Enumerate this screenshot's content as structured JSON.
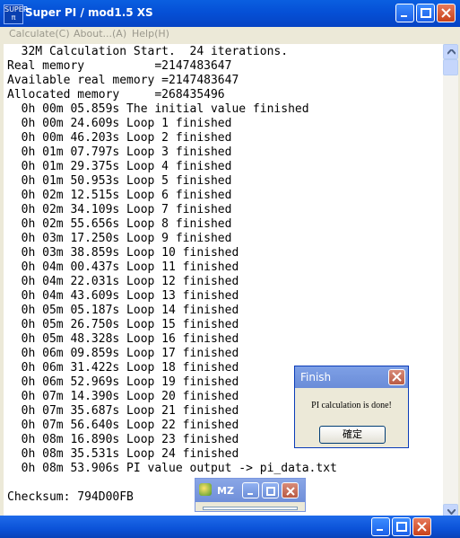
{
  "window": {
    "title": "Super PI / mod1.5 XS",
    "icon_text": [
      "SUPER",
      "π"
    ],
    "buttons": [
      "minimize",
      "maximize",
      "close"
    ]
  },
  "menu": [
    {
      "label": "Calculate(C)"
    },
    {
      "label": "About...(A)"
    },
    {
      "label": "Help(H)"
    }
  ],
  "console": {
    "lines": [
      "  32M Calculation Start.  24 iterations.",
      "Real memory          =2147483647",
      "Available real memory =2147483647",
      "Allocated memory     =268435496",
      "  0h 00m 05.859s The initial value finished",
      "  0h 00m 24.609s Loop 1 finished",
      "  0h 00m 46.203s Loop 2 finished",
      "  0h 01m 07.797s Loop 3 finished",
      "  0h 01m 29.375s Loop 4 finished",
      "  0h 01m 50.953s Loop 5 finished",
      "  0h 02m 12.515s Loop 6 finished",
      "  0h 02m 34.109s Loop 7 finished",
      "  0h 02m 55.656s Loop 8 finished",
      "  0h 03m 17.250s Loop 9 finished",
      "  0h 03m 38.859s Loop 10 finished",
      "  0h 04m 00.437s Loop 11 finished",
      "  0h 04m 22.031s Loop 12 finished",
      "  0h 04m 43.609s Loop 13 finished",
      "  0h 05m 05.187s Loop 14 finished",
      "  0h 05m 26.750s Loop 15 finished",
      "  0h 05m 48.328s Loop 16 finished",
      "  0h 06m 09.859s Loop 17 finished",
      "  0h 06m 31.422s Loop 18 finished",
      "  0h 06m 52.969s Loop 19 finished",
      "  0h 07m 14.390s Loop 20 finished",
      "  0h 07m 35.687s Loop 21 finished",
      "  0h 07m 56.640s Loop 22 finished",
      "  0h 08m 16.890s Loop 23 finished",
      "  0h 08m 35.531s Loop 24 finished",
      "  0h 08m 53.906s PI value output -> pi_data.txt",
      "",
      "Checksum: 794D00FB"
    ]
  },
  "finish_dialog": {
    "title": "Finish",
    "message": "PI calculation is done!",
    "ok_label": "確定"
  },
  "mz_window": {
    "title": "MZ"
  },
  "colors": {
    "titlebar": "#0550d6",
    "dialog_titlebar": "#7ea0e6",
    "close_button": "#c8421a"
  }
}
